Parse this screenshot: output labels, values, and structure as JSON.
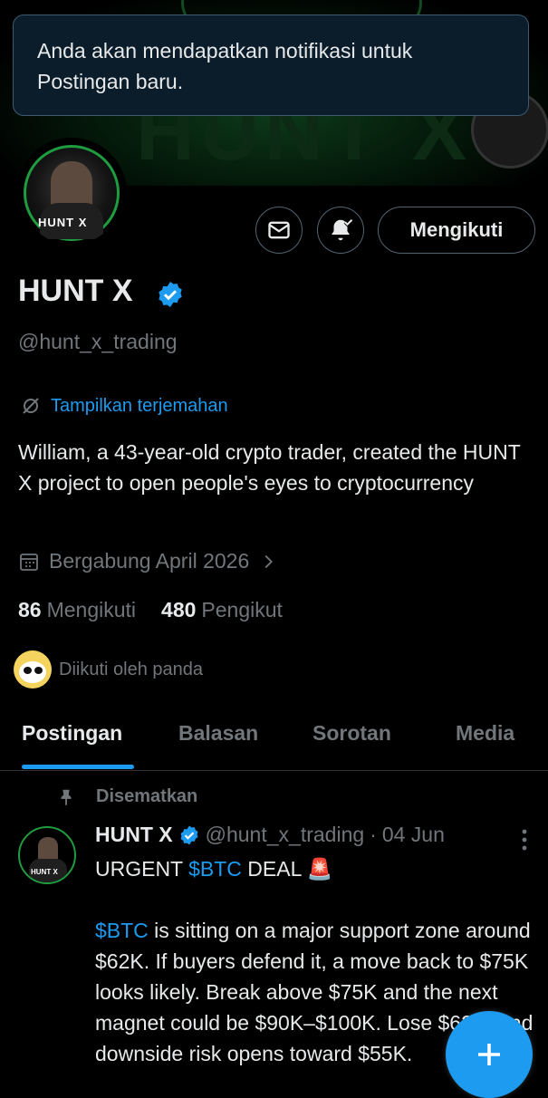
{
  "toast": {
    "message": "Anda akan mendapatkan notifikasi untuk Postingan baru."
  },
  "banner": {
    "logo_text": "HUNT X"
  },
  "avatar": {
    "label": "HUNT X"
  },
  "actions": {
    "follow_label": "Mengikuti",
    "message_icon": "mail-icon",
    "notify_icon": "bell-check-icon"
  },
  "profile": {
    "name": "HUNT X",
    "handle": "@hunt_x_trading",
    "translate_label": "Tampilkan terjemahan",
    "bio": "William, a 43-year-old crypto trader, created the HUNT X project to open people's eyes to cryptocurrency",
    "joined": "Bergabung April 2026",
    "following_count": "86",
    "following_label": "Mengikuti",
    "followers_count": "480",
    "followers_label": "Pengikut",
    "followed_by": "Diikuti oleh panda"
  },
  "tabs": [
    {
      "label": "Postingan",
      "active": true
    },
    {
      "label": "Balasan",
      "active": false
    },
    {
      "label": "Sorotan",
      "active": false
    },
    {
      "label": "Media",
      "active": false
    }
  ],
  "post": {
    "pinned_label": "Disematkan",
    "author": "HUNT X",
    "handle": "@hunt_x_trading",
    "dot": "·",
    "date": "04 Jun",
    "line1_pre": "URGENT ",
    "line1_tag": "$BTC",
    "line1_post": " DEAL 🚨",
    "para_tag": "$BTC",
    "para_text": " is sitting on a major support zone around $62K. If buyers defend it, a move back to $75K looks likely. Break above $75K and the next magnet could be $90K–$100K. Lose $62K, and downside risk opens toward $55K."
  },
  "colors": {
    "accent": "#1d9bf0",
    "muted": "#71767b",
    "text": "#e7e9ea",
    "toast_bg": "#0b1d2a",
    "brand_green": "#1e9c3f"
  }
}
